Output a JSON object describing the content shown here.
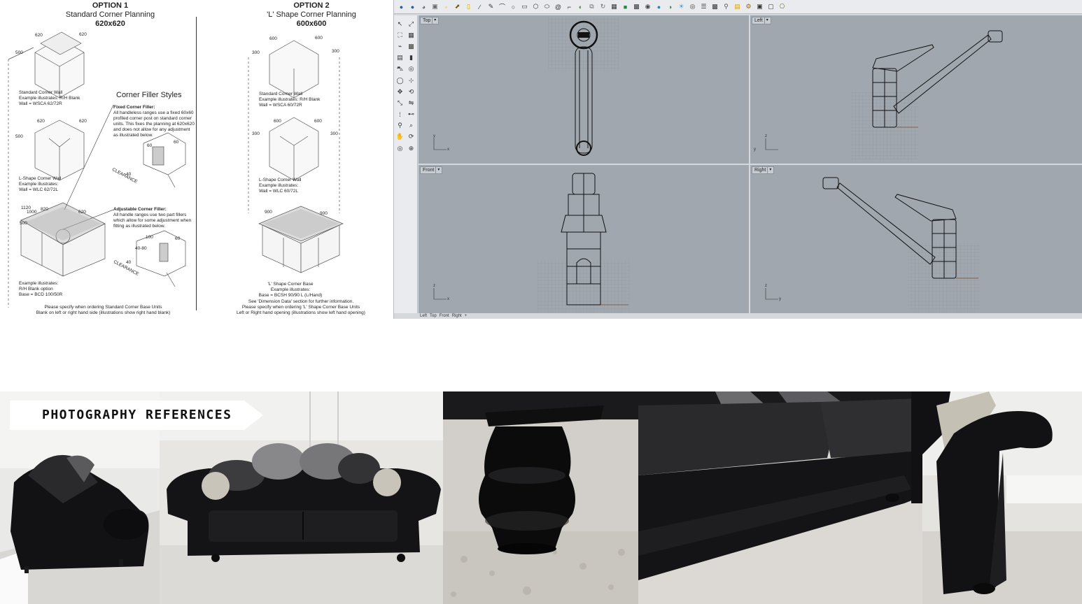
{
  "spec_sheet": {
    "option1": {
      "option": "OPTION 1",
      "subtitle": "Standard Corner Planning",
      "dims": "620x620",
      "dim_labels": [
        "500",
        "620",
        "620",
        "620",
        "620",
        "500",
        "1120",
        "1000",
        "820",
        "500",
        "620"
      ],
      "wall1_note": [
        "Standard Corner Wall",
        "Example illustrates: R/H Blank",
        "Wall = WSCA 62/72R"
      ],
      "wall2_note": [
        "L-Shape Corner Wall",
        "Example illustrates:",
        "Wall = WLC 62/72L"
      ],
      "base_note": [
        "Example illustrates:",
        "R/H Blank option",
        "Base = BCD 100/50R"
      ],
      "footnote": [
        "Please specify when ordering Standard Corner Base Units",
        "Blank on left or right hand side (illustrations show right hand blank)"
      ]
    },
    "filler": {
      "title": "Corner Filler Styles",
      "fixed_heading": "Fixed Corner Filler:",
      "fixed_text": [
        "All handleless ranges use a fixed 60x60",
        "profiled corner post on standard corner",
        "units. This fixes the planning at 620x620",
        "and does not allow for any adjustment",
        "as illustrated below."
      ],
      "adjustable_heading": "Adjustable Corner Filler:",
      "adjustable_text": [
        "All handle ranges use two part fillers",
        "which allow for some adjustment when",
        "fitting as illustrated below."
      ],
      "clearance": "CLEARANCE",
      "dims": [
        "60",
        "60",
        "40",
        "100",
        "60",
        "40-80",
        "40"
      ]
    },
    "option2": {
      "option": "OPTION 2",
      "subtitle": "'L' Shape Corner Planning",
      "dims": "600x600",
      "dim_labels": [
        "300",
        "600",
        "600",
        "300",
        "300",
        "600",
        "600",
        "300",
        "900",
        "900"
      ],
      "wall1_note": [
        "Standard Corner Wall",
        "Example illustrates: R/H Blank",
        "Wall = WSCA 60/72R"
      ],
      "wall2_note": [
        "L-Shape Corner Wall",
        "Example illustrates:",
        "Wall = WLC 60/72L"
      ],
      "base_note": [
        "'L' Shape Corner Base",
        "Example illustrates:",
        "Base = BCSH 90/90 L (L/Hand)"
      ],
      "footnote": [
        "See 'Dimension Data' section for further information.",
        "Please specify when ordering 'L' Shape Corner Base Units",
        "Left or Right hand opening (illustrations show left hand opening)"
      ]
    }
  },
  "cad": {
    "toolbar_icons": [
      "sphere-icon",
      "sphere-icon",
      "cursor-icon",
      "select-icon",
      "point-icon",
      "polyline-icon",
      "line-icon",
      "curve-icon",
      "pencil-icon",
      "arc-icon",
      "circle-icon",
      "rectangle-icon",
      "polygon-icon",
      "ellipse-icon",
      "spiral-icon",
      "fillet-icon",
      "surface-icon",
      "loft-icon",
      "revolve-icon",
      "box-icon",
      "solid-icon",
      "mesh-icon",
      "render-icon",
      "sphere-shaded-icon",
      "material-icon",
      "light-icon",
      "camera-icon",
      "layer-icon",
      "checker-icon",
      "pin-icon",
      "folder-icon",
      "gear-icon",
      "panel-icon",
      "display-icon",
      "script-icon"
    ],
    "side_icons": [
      "arrow-icon",
      "zoom-extents-icon",
      "point-cloud-icon",
      "grid-icon",
      "curve-tool-icon",
      "cage-icon",
      "layer-stack-icon",
      "box-icon",
      "vehicle-icon",
      "sphere-icon",
      "cylinder-icon",
      "transform-icon",
      "move-icon",
      "rotate-icon",
      "scale-icon",
      "mirror-icon",
      "array-icon",
      "join-icon",
      "analyze-icon",
      "zoom-icon",
      "pan-icon",
      "rotate-view-icon",
      "target-icon",
      "snap-icon"
    ],
    "viewports": {
      "top": {
        "label": "Top",
        "axis_x": "x",
        "axis_y": "y"
      },
      "left": {
        "label": "Left",
        "axis_x": "y",
        "axis_y": "z"
      },
      "front": {
        "label": "Front",
        "axis_x": "x",
        "axis_y": "z"
      },
      "right": {
        "label": "Right",
        "axis_x": "y",
        "axis_y": "z"
      }
    },
    "bottom_tabs": [
      "Left",
      "Top",
      "Front",
      "Right",
      "+"
    ],
    "colors": {
      "viewport": "#a1a7ae",
      "chrome": "#e9ebee",
      "wire": "#111111"
    }
  },
  "photos": {
    "banner": "PHOTOGRAPHY REFERENCES",
    "colors": {
      "fabric": "#141416",
      "floor": "#d8d6d2",
      "wall": "#e8e8e6"
    }
  }
}
